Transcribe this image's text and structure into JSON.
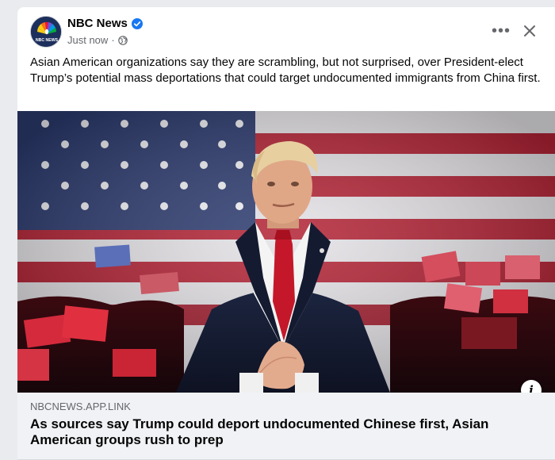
{
  "post": {
    "page_name": "NBC News",
    "timestamp": "Just now",
    "separator": "·",
    "text": "Asian American organizations say they are scrambling, but not surprised, over President-elect Trump’s potential mass deportations that could target undocumented immigrants from China first.",
    "more_icon": "•••"
  },
  "avatar": {
    "logo_text": "NBC NEWS"
  },
  "link": {
    "domain": "NBCNEWS.APP.LINK",
    "title": "As sources say Trump could deport undocumented Chinese first, Asian American groups rush to prep"
  },
  "info_icon": "i",
  "colors": {
    "verified": "#1877f2",
    "text_primary": "#050505",
    "text_secondary": "#65676b",
    "link_bg": "#f0f2f5",
    "flag_red": "#b22234",
    "flag_blue": "#2b3a6e"
  },
  "icons": [
    "verified-badge-icon",
    "globe-icon",
    "more-options-icon",
    "close-icon",
    "info-icon"
  ]
}
